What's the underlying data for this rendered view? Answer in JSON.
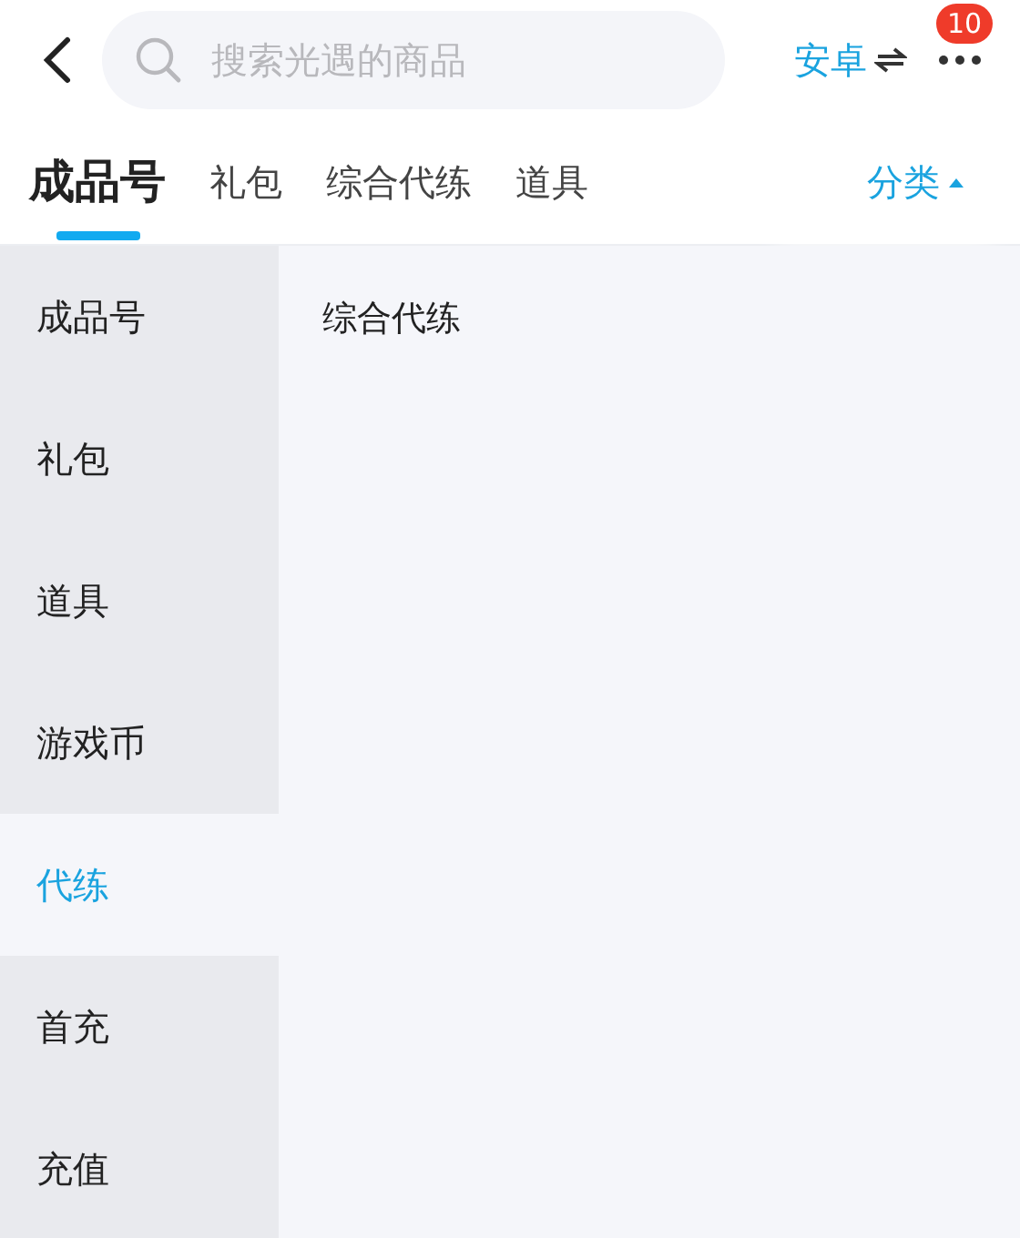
{
  "search": {
    "placeholder": "搜索光遇的商品"
  },
  "platform": {
    "label": "安卓"
  },
  "more": {
    "badge": "10"
  },
  "tabs": [
    {
      "label": "成品号",
      "selected": true
    },
    {
      "label": "礼包",
      "selected": false
    },
    {
      "label": "综合代练",
      "selected": false
    },
    {
      "label": "道具",
      "selected": false
    }
  ],
  "category_toggle": {
    "label": "分类",
    "expanded": true
  },
  "sidebar": {
    "items": [
      {
        "label": "成品号",
        "selected": false
      },
      {
        "label": "礼包",
        "selected": false
      },
      {
        "label": "道具",
        "selected": false
      },
      {
        "label": "游戏币",
        "selected": false
      },
      {
        "label": "代练",
        "selected": true
      },
      {
        "label": "首充",
        "selected": false
      },
      {
        "label": "充值",
        "selected": false
      }
    ]
  },
  "content": {
    "items": [
      "综合代练"
    ]
  }
}
